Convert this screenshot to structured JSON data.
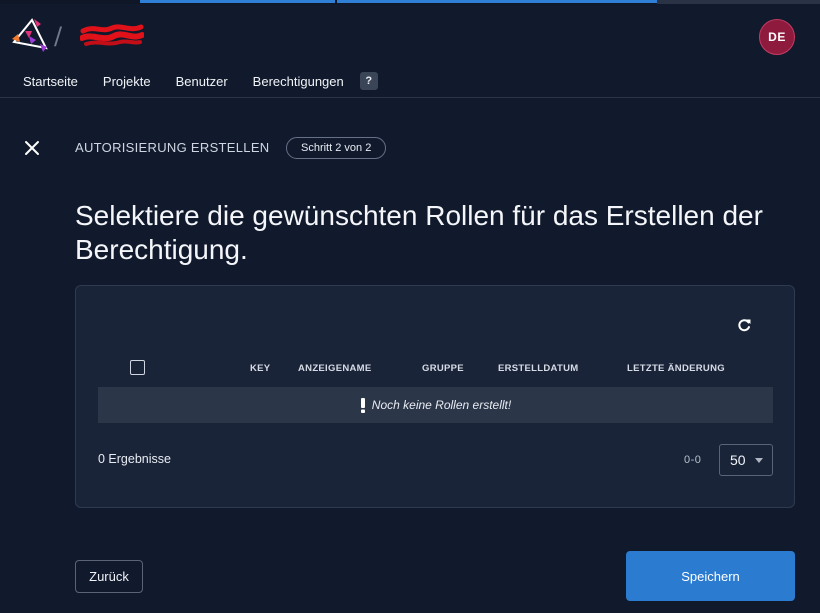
{
  "header": {
    "separator": "/",
    "org_name": "",
    "avatar_initials": "DE"
  },
  "nav": {
    "items": [
      {
        "label": "Startseite"
      },
      {
        "label": "Projekte"
      },
      {
        "label": "Benutzer"
      },
      {
        "label": "Berechtigungen"
      }
    ],
    "help_label": "?"
  },
  "flow": {
    "title": "AUTORISIERUNG ERSTELLEN",
    "step": "Schritt 2 von 2",
    "headline": "Selektiere die gewünschten Rollen für das Erstellen der Berechtigung."
  },
  "table": {
    "columns": [
      {
        "label": "KEY"
      },
      {
        "label": "ANZEIGENAME"
      },
      {
        "label": "GRUPPE"
      },
      {
        "label": "ERSTELLDATUM"
      },
      {
        "label": "LETZTE ÄNDERUNG"
      }
    ],
    "empty_message": "Noch keine Rollen erstellt!",
    "results": "0 Ergebnisse",
    "range": "0-0",
    "page_size": "50"
  },
  "actions": {
    "back_label": "Zurück",
    "save_label": "Speichern"
  },
  "colors": {
    "background": "#111a2c",
    "card": "#1a2438",
    "primary": "#2b7bd0",
    "avatar": "#8e1b3d"
  },
  "icons": {
    "close": "close-icon",
    "refresh": "refresh-icon",
    "warning": "exclamation-icon",
    "dropdown": "chevron-down-icon"
  }
}
